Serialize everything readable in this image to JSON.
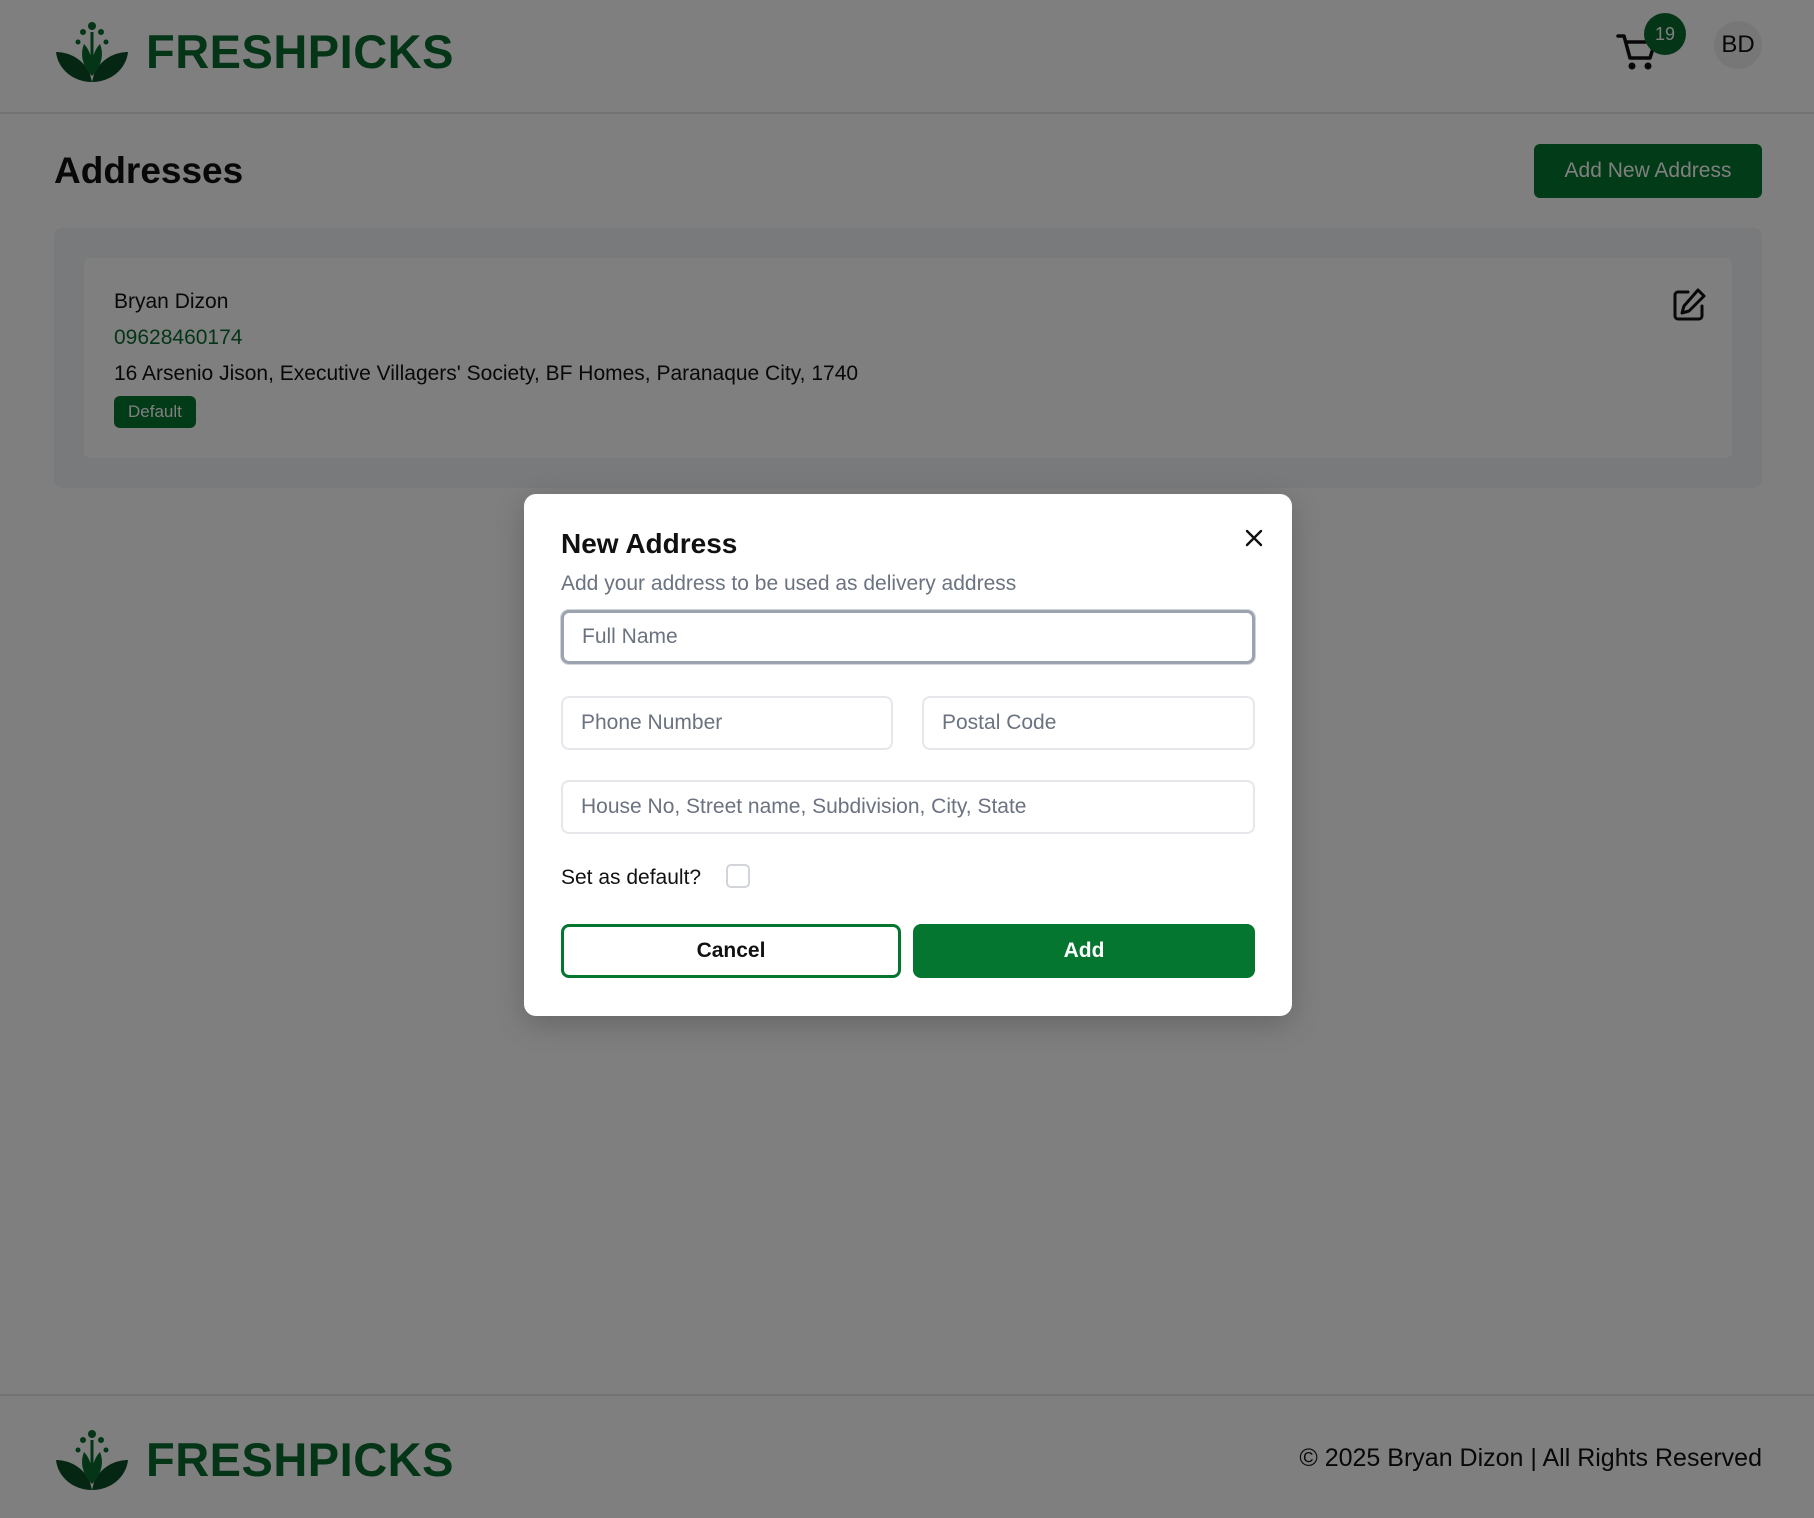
{
  "brand": {
    "name": "FRESHPICKS",
    "logo_icon": "leaf-logo-icon",
    "color": "#0b6b2f"
  },
  "header": {
    "cart_icon": "cart-icon",
    "cart_count": "19",
    "avatar_initials": "BD"
  },
  "page": {
    "title": "Addresses",
    "add_button_label": "Add New Address"
  },
  "addresses": [
    {
      "name": "Bryan Dizon",
      "phone": "09628460174",
      "line": "16 Arsenio Jison, Executive Villagers' Society, BF Homes, Paranaque City, 1740",
      "badge": "Default",
      "edit_icon": "edit-icon"
    }
  ],
  "modal": {
    "title": "New Address",
    "subtitle": "Add your address to be used as delivery address",
    "close_icon": "close-icon",
    "fields": {
      "full_name": {
        "placeholder": "Full Name",
        "value": ""
      },
      "phone": {
        "placeholder": "Phone Number",
        "value": ""
      },
      "postal": {
        "placeholder": "Postal Code",
        "value": ""
      },
      "address": {
        "placeholder": "House No, Street name, Subdivision, City, State",
        "value": ""
      }
    },
    "default_label": "Set as default?",
    "default_checked": false,
    "cancel_label": "Cancel",
    "add_label": "Add"
  },
  "footer": {
    "copyright": "© 2025 Bryan Dizon | All Rights Reserved"
  },
  "colors": {
    "accent": "#05762f",
    "overlay": "rgba(0,0,0,0.5)"
  }
}
